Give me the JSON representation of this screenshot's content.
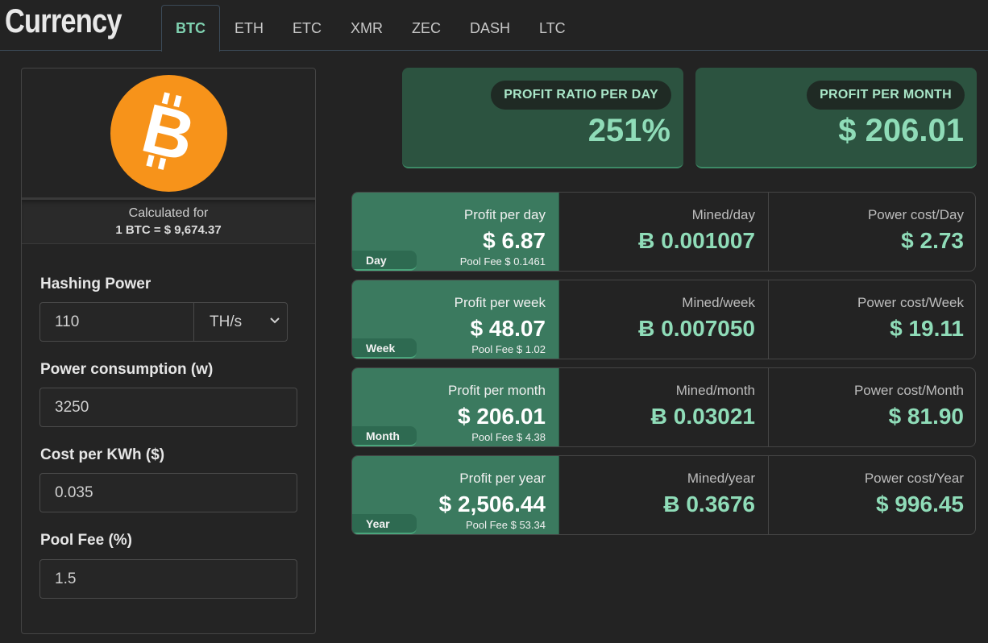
{
  "app": {
    "title": "Currency"
  },
  "tabs": [
    {
      "label": "BTC",
      "active": true
    },
    {
      "label": "ETH",
      "active": false
    },
    {
      "label": "ETC",
      "active": false
    },
    {
      "label": "XMR",
      "active": false
    },
    {
      "label": "ZEC",
      "active": false
    },
    {
      "label": "DASH",
      "active": false
    },
    {
      "label": "LTC",
      "active": false
    }
  ],
  "sidebar": {
    "coin_icon": "bitcoin-icon",
    "calc_label": "Calculated for",
    "calc_value": "1 BTC = $ 9,674.37",
    "hashing_power": {
      "label": "Hashing Power",
      "value": "110",
      "unit": "TH/s"
    },
    "power_consumption": {
      "label": "Power consumption (w)",
      "value": "3250"
    },
    "cost_per_kwh": {
      "label": "Cost per KWh ($)",
      "value": "0.035"
    },
    "pool_fee": {
      "label": "Pool Fee (%)",
      "value": "1.5"
    }
  },
  "summary": {
    "ratio": {
      "label": "PROFIT RATIO PER DAY",
      "value": "251%"
    },
    "month": {
      "label": "PROFIT PER MONTH",
      "value": "$ 206.01"
    }
  },
  "rows": [
    {
      "tag": "Day",
      "profit_label": "Profit per day",
      "profit_value": "$ 6.87",
      "pool_fee": "Pool Fee $ 0.1461",
      "mined_label": "Mined/day",
      "mined_value": "Ƀ 0.001007",
      "power_label": "Power cost/Day",
      "power_value": "$ 2.73"
    },
    {
      "tag": "Week",
      "profit_label": "Profit per week",
      "profit_value": "$ 48.07",
      "pool_fee": "Pool Fee $ 1.02",
      "mined_label": "Mined/week",
      "mined_value": "Ƀ 0.007050",
      "power_label": "Power cost/Week",
      "power_value": "$ 19.11"
    },
    {
      "tag": "Month",
      "profit_label": "Profit per month",
      "profit_value": "$ 206.01",
      "pool_fee": "Pool Fee $ 4.38",
      "mined_label": "Mined/month",
      "mined_value": "Ƀ 0.03021",
      "power_label": "Power cost/Month",
      "power_value": "$ 81.90"
    },
    {
      "tag": "Year",
      "profit_label": "Profit per year",
      "profit_value": "$ 2,506.44",
      "pool_fee": "Pool Fee $ 53.34",
      "mined_label": "Mined/year",
      "mined_value": "Ƀ 0.3676",
      "power_label": "Power cost/Year",
      "power_value": "$ 996.45"
    }
  ],
  "colors": {
    "accent": "#7fd1b0",
    "card_bg": "#3b7a5f",
    "bitcoin": "#f7931a"
  }
}
